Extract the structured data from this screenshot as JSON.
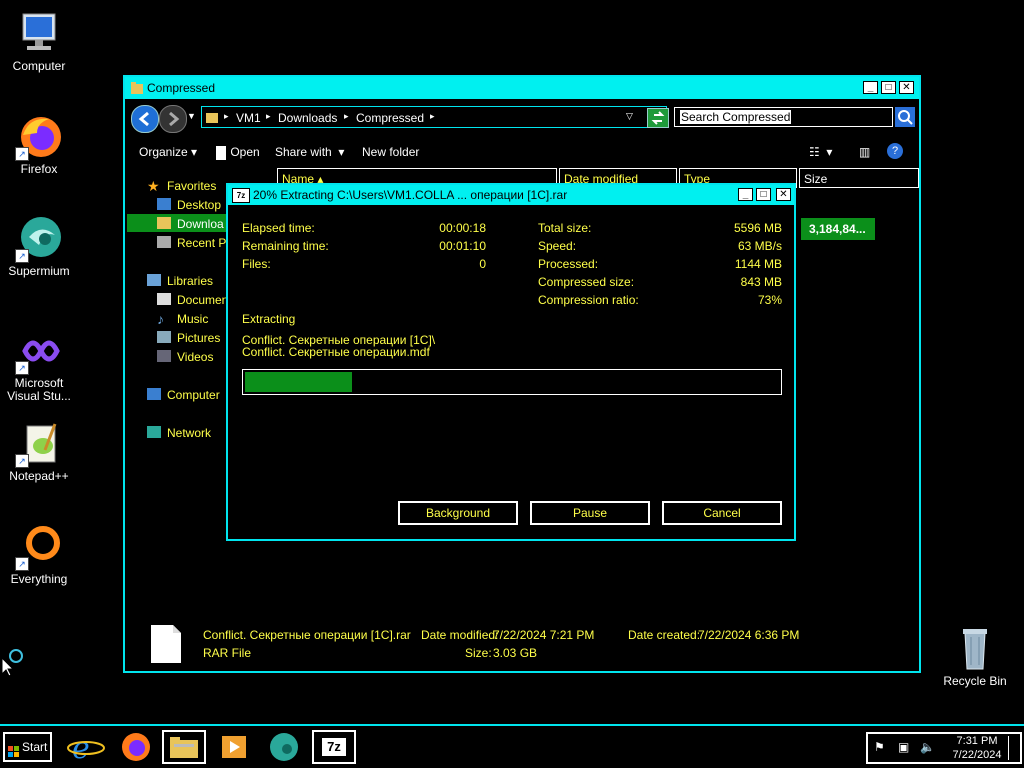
{
  "desktop": {
    "icons": [
      {
        "label": "Computer"
      },
      {
        "label": "Firefox"
      },
      {
        "label": "Supermium"
      },
      {
        "label": "Microsoft Visual Stu..."
      },
      {
        "label": "Notepad++"
      },
      {
        "label": "Everything"
      },
      {
        "label": "Recycle Bin"
      }
    ]
  },
  "explorer": {
    "title": "Compressed",
    "breadcrumbs": [
      "VM1",
      "Downloads",
      "Compressed"
    ],
    "search_placeholder": "Search Compressed",
    "toolbar": {
      "organize": "Organize",
      "open": "Open",
      "share_with": "Share with",
      "new_folder": "New folder"
    },
    "columns": {
      "name": "Name",
      "date_modified": "Date modified",
      "type": "Type",
      "size": "Size"
    },
    "selected_row_size": "3,184,84...",
    "nav": {
      "favorites": "Favorites",
      "desktop": "Desktop",
      "downloads": "Downloa",
      "recent": "Recent P",
      "libraries": "Libraries",
      "documents": "Documen",
      "music": "Music",
      "pictures": "Pictures",
      "videos": "Videos",
      "computer": "Computer",
      "network": "Network"
    },
    "details": {
      "filename": "Conflict. Секретные операции [1C].rar",
      "date_modified_label": "Date modified:",
      "date_modified": "7/22/2024 7:21 PM",
      "date_created_label": "Date created:",
      "date_created": "7/22/2024 6:36 PM",
      "file_type": "RAR File",
      "size_label": "Size:",
      "size": "3.03 GB"
    }
  },
  "dialog": {
    "title": "20% Extracting C:\\Users\\VM1.COLLA ...  операции [1C].rar",
    "progress": 0.2,
    "left_stats": [
      {
        "label": "Elapsed time:",
        "value": "00:00:18"
      },
      {
        "label": "Remaining time:",
        "value": "00:01:10"
      },
      {
        "label": "Files:",
        "value": "0"
      }
    ],
    "right_stats": [
      {
        "label": "Total size:",
        "value": "5596 MB"
      },
      {
        "label": "Speed:",
        "value": "63 MB/s"
      },
      {
        "label": "Processed:",
        "value": "1144 MB"
      },
      {
        "label": "Compressed size:",
        "value": "843 MB"
      },
      {
        "label": "Compression ratio:",
        "value": "73%"
      }
    ],
    "status": "Extracting",
    "line1": "Conflict. Секретные операции [1C]\\",
    "line2": "Conflict. Секретные операции.mdf",
    "buttons": {
      "background": "Background",
      "pause": "Pause",
      "cancel": "Cancel"
    }
  },
  "taskbar": {
    "start_label": "Start",
    "clock_time": "7:31 PM",
    "clock_date": "7/22/2024",
    "sevenzip_label": "7z"
  },
  "colors": {
    "accent": "#00e5ee",
    "text": "#ffff4a",
    "progress": "#0b8f1a"
  }
}
